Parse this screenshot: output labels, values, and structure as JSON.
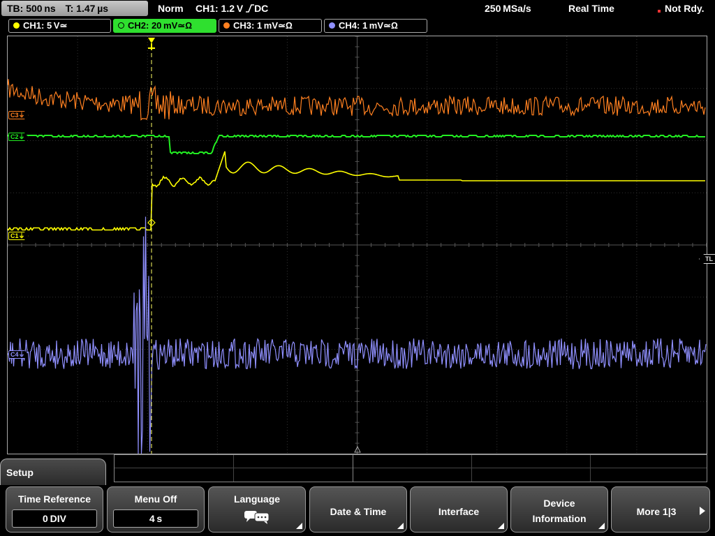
{
  "status_bar": {
    "timebase": "TB: 500 ns",
    "trigger_time": "T: 1.47 µs",
    "trigger_mode": "Norm",
    "trigger_source": "CH1: 1.2 V",
    "trigger_coupling": "DC",
    "sample_rate": "250 MSa/s",
    "acquisition_mode": "Real Time",
    "state": "Not Rdy."
  },
  "channels": [
    {
      "label": "CH1: 5 V≃",
      "color": "#ffff00",
      "active": false
    },
    {
      "label": "CH2: 20 mV≃Ω",
      "color": "#22ee22",
      "active": true
    },
    {
      "label": "CH3: 1 mV≃Ω",
      "color": "#ff8020",
      "active": false
    },
    {
      "label": "CH4: 1 mV≃Ω",
      "color": "#9090ff",
      "active": false
    }
  ],
  "markers": {
    "c3": "C3⏚",
    "c2": "C2⏚",
    "c1": "C1⏚",
    "c4": "C4⏚",
    "trigger_level": "TL",
    "trigger_position": "T"
  },
  "menu": {
    "title": "Setup",
    "keys": [
      {
        "label": "Time Reference",
        "value": "0 DIV"
      },
      {
        "label": "Menu Off",
        "value": "4 s"
      },
      {
        "label": "Language",
        "icon": "speech-bubbles-icon"
      },
      {
        "label": "Date & Time"
      },
      {
        "label": "Interface"
      },
      {
        "label": "Device",
        "label2": "Information"
      },
      {
        "label": "More 1|3"
      }
    ]
  },
  "colors": {
    "ch1": "#ffff00",
    "ch2": "#22ee22",
    "ch3": "#ff8020",
    "ch4": "#9090ff",
    "grid": "#3a3a3a"
  }
}
